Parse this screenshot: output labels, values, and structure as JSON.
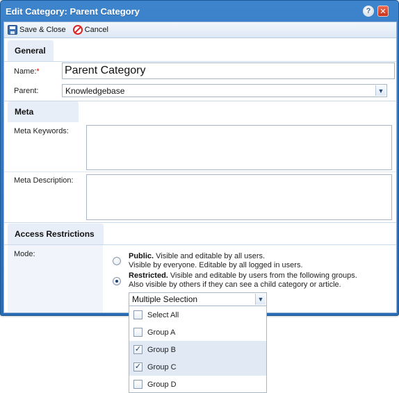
{
  "window": {
    "title": "Edit Category: Parent Category",
    "help_icon": "question-mark-icon",
    "close_icon": "close-icon"
  },
  "toolbar": {
    "save_label": "Save & Close",
    "cancel_label": "Cancel"
  },
  "general": {
    "heading": "General",
    "name_label": "Name:",
    "required_marker": "*",
    "name_value": "Parent Category",
    "parent_label": "Parent:",
    "parent_value": "Knowledgebase"
  },
  "meta": {
    "heading": "Meta",
    "keywords_label": "Meta Keywords:",
    "keywords_value": "",
    "description_label": "Meta Description:",
    "description_value": ""
  },
  "access": {
    "heading": "Access Restrictions",
    "mode_label": "Mode:",
    "options": [
      {
        "title": "Public.",
        "desc1": " Visible and editable by all users.",
        "desc2": "Visible by everyone. Editable by all logged in users.",
        "checked": false
      },
      {
        "title": "Restricted.",
        "desc1": " Visible and editable by users from the following groups.",
        "desc2": "Also visible by others if they can see a child category or article.",
        "checked": true
      }
    ],
    "groups_select_value": "Multiple Selection",
    "groups": [
      {
        "label": "Select All",
        "checked": false
      },
      {
        "label": "Group A",
        "checked": false
      },
      {
        "label": "Group B",
        "checked": true
      },
      {
        "label": "Group C",
        "checked": true
      },
      {
        "label": "Group D",
        "checked": false
      }
    ]
  },
  "colors": {
    "titlebar": "#2a6bb5",
    "section_header_bg": "#e7eef8",
    "selected_row_bg": "#e1e9f5"
  }
}
